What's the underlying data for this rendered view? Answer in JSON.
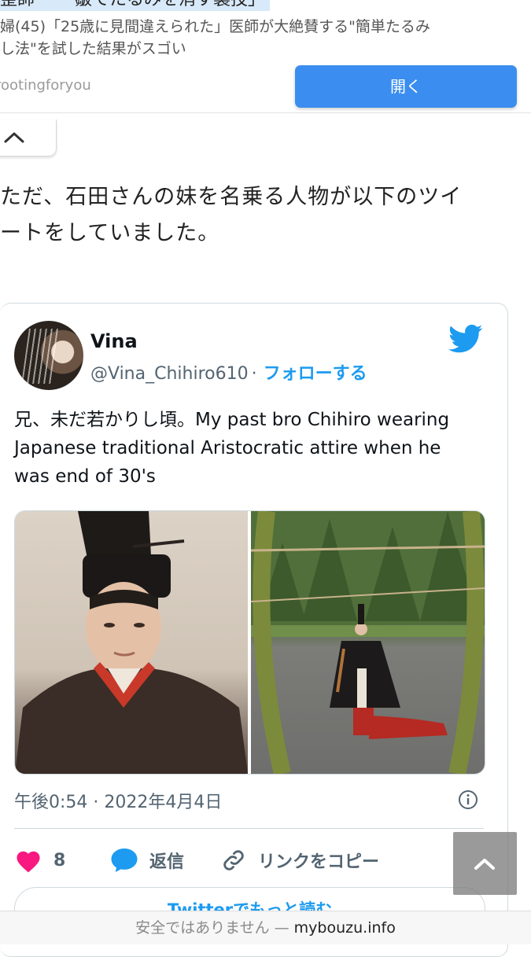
{
  "ad": {
    "top_text": "整師 　　皺てたるみを消す裏技」",
    "desc_line1": "婦(45)「25歳に見間違えられた」医師が大絶賛する\"簡単たるみ",
    "desc_line2": "し法\"を試した結果がスゴい",
    "source": "rootingforyou",
    "open_button": "開く"
  },
  "article": {
    "line1": "ただ、石田さんの妹を名乗る人物が以下のツイ",
    "line2": "ートをしていました。"
  },
  "tweet": {
    "user_name": "Vina",
    "handle": "@Vina_Chihiro610",
    "separator": "·",
    "follow": "フォローする",
    "text_line1": "兄、未だ若かりし頃。My past bro Chihiro wearing",
    "text_line2": "Japanese traditional Aristocratic attire when he",
    "text_line3": "was end of 30's",
    "timestamp": "午後0:54 · 2022年4月4日",
    "like_count": "8",
    "reply_label": "返信",
    "copy_link_label": "リンクをコピー",
    "more_button": "Twitterでもっと読む"
  },
  "url_bar": {
    "warning": "安全ではありません —",
    "domain": "mybouzu.info"
  },
  "colors": {
    "twitter_blue": "#1d9bf0",
    "like_pink": "#f91880",
    "open_button_blue": "#3b8ef0"
  },
  "icons": [
    "chevron-up-icon",
    "twitter-bird-icon",
    "info-icon",
    "heart-icon",
    "reply-bubble-icon",
    "link-icon"
  ]
}
